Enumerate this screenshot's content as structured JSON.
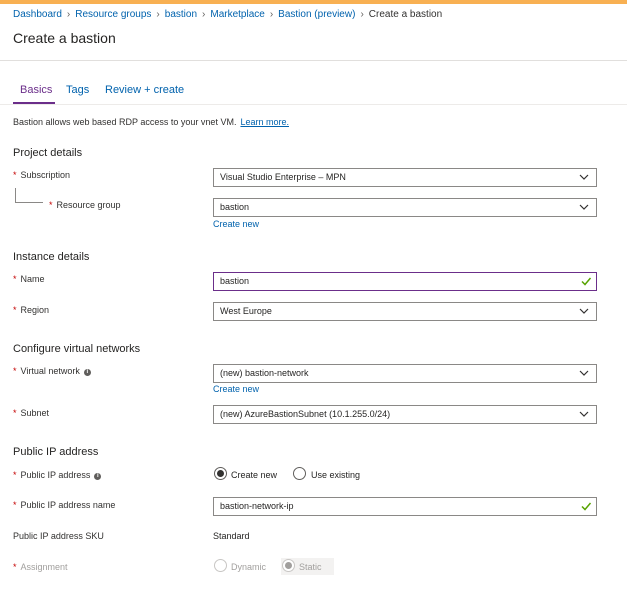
{
  "breadcrumb": {
    "items": [
      "Dashboard",
      "Resource groups",
      "bastion",
      "Marketplace",
      "Bastion (preview)"
    ],
    "current": "Create a bastion",
    "separator": "›"
  },
  "page": {
    "title": "Create a bastion"
  },
  "tabs": [
    "Basics",
    "Tags",
    "Review + create"
  ],
  "intro": {
    "text": "Bastion allows web based RDP access to your vnet VM.",
    "link": "Learn more."
  },
  "project_details": {
    "heading": "Project details",
    "subscription": {
      "label": "Subscription",
      "value": "Visual Studio Enterprise – MPN"
    },
    "resource_group": {
      "label": "Resource group",
      "value": "bastion",
      "create_new": "Create new"
    }
  },
  "instance_details": {
    "heading": "Instance details",
    "name": {
      "label": "Name",
      "value": "bastion"
    },
    "region": {
      "label": "Region",
      "value": "West Europe"
    }
  },
  "virtual_networks": {
    "heading": "Configure virtual networks",
    "virtual_network": {
      "label": "Virtual network",
      "value": "(new) bastion-network",
      "create_new": "Create new"
    },
    "subnet": {
      "label": "Subnet",
      "value": "(new) AzureBastionSubnet (10.1.255.0/24)"
    }
  },
  "public_ip": {
    "heading": "Public IP address",
    "address": {
      "label": "Public IP address",
      "options": [
        "Create new",
        "Use existing"
      ],
      "selected": "Create new"
    },
    "name": {
      "label": "Public IP address name",
      "value": "bastion-network-ip"
    },
    "sku": {
      "label": "Public IP address SKU",
      "value": "Standard"
    },
    "assignment": {
      "label": "Assignment",
      "options": [
        "Dynamic",
        "Static"
      ],
      "selected": "Static"
    }
  },
  "colors": {
    "accent": "#6b2e8a",
    "link": "#0062ad",
    "required": "#c40000",
    "valid": "#57a300",
    "topbar": "#f8b052"
  },
  "required_marker": "*",
  "icons": [
    "chevron-down-icon",
    "checkmark-icon",
    "info-icon"
  ]
}
